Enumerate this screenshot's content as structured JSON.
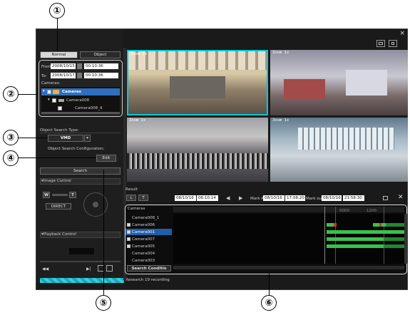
{
  "window": {
    "close_glyph": "×"
  },
  "top_tabs": {
    "normal": "Normal",
    "object": "Object"
  },
  "search_range": {
    "from_label": "From:",
    "from_date": "2008/10/15",
    "from_time": "00:10:36",
    "to_label": "To:",
    "to_date": "2008/10/17",
    "to_time": "00:10:36",
    "cameras_label": "Cameras:"
  },
  "camera_tree": {
    "root": "Cameras",
    "child": "Camera008",
    "sub": "Camera008_4"
  },
  "object_search": {
    "type_label": "Object Search Type:",
    "type_value": "VMD",
    "config_label": "Object Search Configuration:",
    "edit_button": "Edit",
    "search_button": "Search"
  },
  "image_control": {
    "header": "▾Image Control",
    "wide": "W",
    "tele": "T",
    "direct": "DIRECT"
  },
  "playback_control": {
    "header": "▾Playback Control"
  },
  "progress": {
    "label": "Research 19 recording"
  },
  "tiles": [
    {
      "zoom": "Zoom 1x"
    },
    {
      "zoom": "Zoom 1x"
    },
    {
      "zoom": "Zoom 1x"
    },
    {
      "zoom": "Zoom 1x"
    }
  ],
  "result": {
    "label": "Result",
    "date1": "08/10/16",
    "time1": "06:10:14",
    "mark_a_label": "Mark A",
    "mark_a_date": "08/10/16",
    "mark_a_time": "17:08:20",
    "mark_out_label": "Mark out",
    "mark_out_date": "08/10/16",
    "mark_out_time": "21:58:30"
  },
  "timeline": {
    "header": "Cameras",
    "ruler": [
      "0000",
      "1200"
    ],
    "cameras": [
      "Camera008_1",
      "Camera006",
      "Camera001",
      "Camera007",
      "Camera005",
      "Camera004",
      "Camera003"
    ],
    "footer": "Search Conditio"
  },
  "callouts": [
    "①",
    "②",
    "③",
    "④",
    "⑤",
    "⑥"
  ],
  "colors": {
    "accent_cyan": "#00c8d8",
    "bar_green": "#39c24b",
    "bar_red": "#d23030",
    "selection_blue": "#1f5fa8"
  }
}
